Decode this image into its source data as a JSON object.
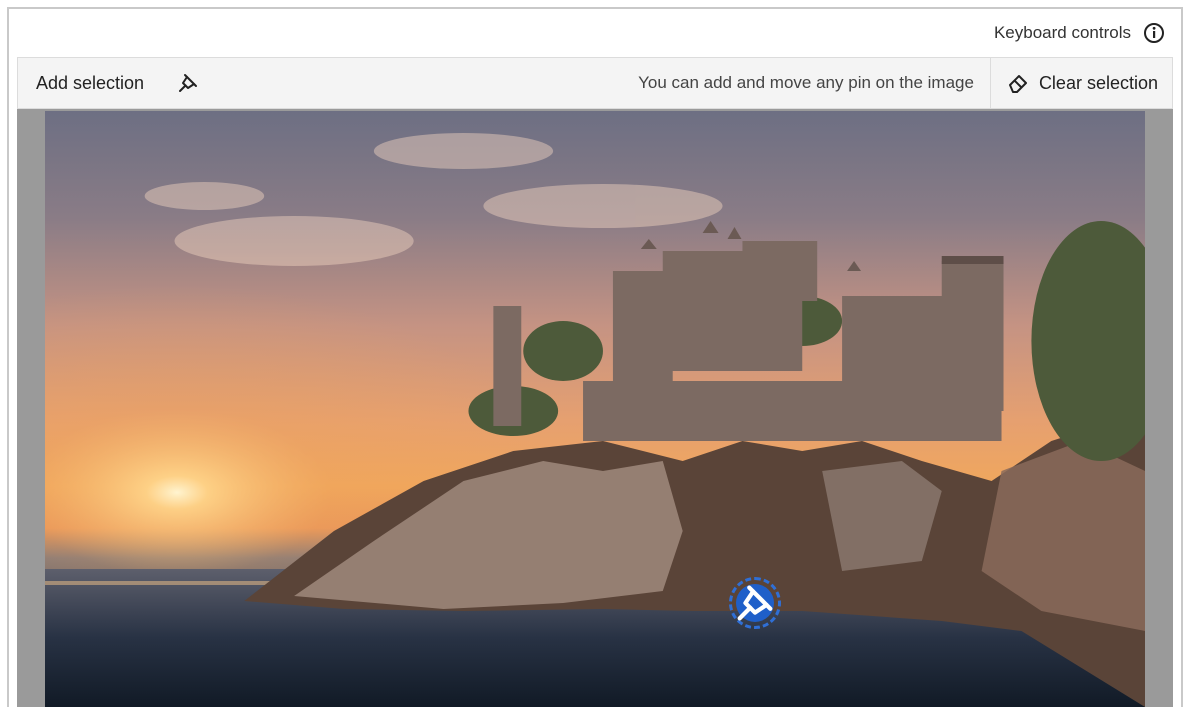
{
  "header": {
    "keyboard_controls_label": "Keyboard controls",
    "info_icon": "info-icon"
  },
  "toolbar": {
    "add_selection_label": "Add selection",
    "add_pin_icon": "pin-icon",
    "hint_text": "You can add and move any pin on the image",
    "clear_selection_label": "Clear selection",
    "clear_icon": "eraser-icon"
  },
  "image": {
    "pins_count": 1,
    "pin_icon": "pin-icon"
  },
  "colors": {
    "accent": "#1f5fc9",
    "toolbar_bg": "#f4f4f4",
    "border": "#dcdcdc"
  }
}
